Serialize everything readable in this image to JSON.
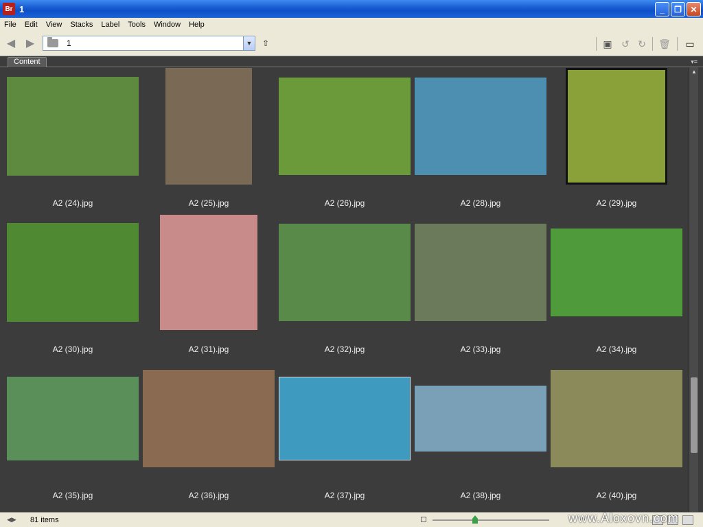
{
  "window": {
    "app_icon_label": "Br",
    "title": "1",
    "minimize_glyph": "_",
    "maximize_glyph": "❐",
    "close_glyph": "✕"
  },
  "menu": [
    "File",
    "Edit",
    "View",
    "Stacks",
    "Label",
    "Tools",
    "Window",
    "Help"
  ],
  "toolbar": {
    "path_value": "1",
    "back_icon": "back-arrow-icon",
    "forward_icon": "forward-arrow-icon"
  },
  "content_tab": "Content",
  "thumbnails": [
    {
      "name": "A2 (24).jpg",
      "color": "#5d8a3f"
    },
    {
      "name": "A2 (25).jpg",
      "color": "#7a6a55"
    },
    {
      "name": "A2 (26).jpg",
      "color": "#6b9a3a"
    },
    {
      "name": "A2 (28).jpg",
      "color": "#4d8fb0"
    },
    {
      "name": "A2 (29).jpg",
      "color": "#8aa13a",
      "selected": true
    },
    {
      "name": "A2 (30).jpg",
      "color": "#4f8a32"
    },
    {
      "name": "A2 (31).jpg",
      "color": "#c98a8a"
    },
    {
      "name": "A2 (32).jpg",
      "color": "#5a8a4a"
    },
    {
      "name": "A2 (33).jpg",
      "color": "#6a7a5a"
    },
    {
      "name": "A2 (34).jpg",
      "color": "#4f9a3a"
    },
    {
      "name": "A2 (35).jpg",
      "color": "#5a8f5a"
    },
    {
      "name": "A2 (36).jpg",
      "color": "#8a6a50"
    },
    {
      "name": "A2 (37).jpg",
      "color": "#3f9ac0"
    },
    {
      "name": "A2 (38).jpg",
      "color": "#7aa0b8"
    },
    {
      "name": "A2 (40).jpg",
      "color": "#8a8a5a"
    }
  ],
  "status": {
    "count": "81 items"
  },
  "watermark": "www.Aloxovn.com"
}
